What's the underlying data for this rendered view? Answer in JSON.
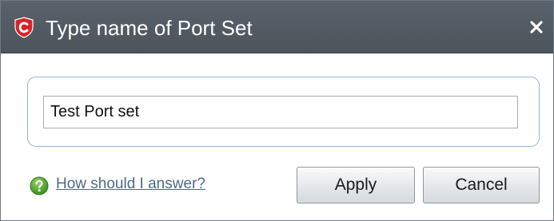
{
  "dialog": {
    "title": "Type name of Port Set",
    "close_label": "×",
    "icon": "comodo-shield-icon",
    "colors": {
      "titlebar": "#515a62",
      "title_text": "#ffffff",
      "group_border": "#8fb5d8",
      "link": "#4d6a84",
      "help_icon": "#4fa22f",
      "brand_red": "#d8222a"
    }
  },
  "form": {
    "port_set_name": "Test Port set"
  },
  "footer": {
    "help_icon": "question-circle-icon",
    "help_link": "How should I answer?",
    "apply_label": "Apply",
    "cancel_label": "Cancel"
  }
}
